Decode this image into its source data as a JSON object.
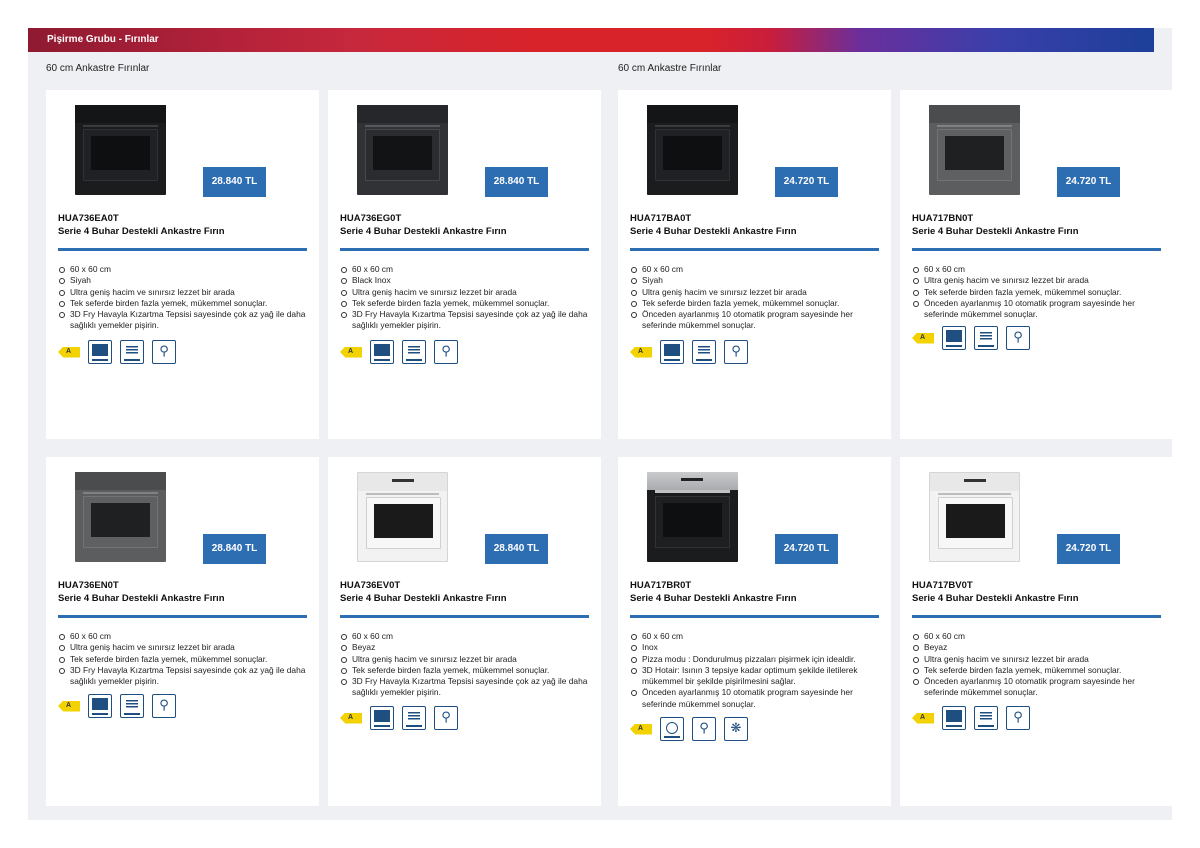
{
  "banner": {
    "title": "Pişirme Grubu - Fırınlar"
  },
  "sections": [
    "60 cm Ankastre Fırınlar",
    "60 cm Ankastre Fırınlar"
  ],
  "colors": {
    "accent": "#2d6db2",
    "energy": "#f2d200",
    "icon": "#1f4e80"
  },
  "products": [
    {
      "model": "HUA736EA0T",
      "name": "Serie 4 Buhar Destekli Ankastre Fırın",
      "price": "28.840 TL",
      "features": [
        "60 x 60 cm",
        "Siyah",
        "Ultra geniş hacim ve sınırsız lezzet bir arada",
        "Tek seferde birden fazla yemek, mükemmel sonuçlar.",
        "3D Fry Havayla Kızartma Tepsisi sayesinde çok az yağ ile daha sağlıklı yemekler pişirin."
      ]
    },
    {
      "model": "HUA736EG0T",
      "name": "Serie 4 Buhar Destekli Ankastre Fırın",
      "price": "28.840 TL",
      "features": [
        "60 x 60 cm",
        "Black Inox",
        "Ultra geniş hacim ve sınırsız lezzet bir arada",
        "Tek seferde birden fazla yemek, mükemmel sonuçlar.",
        "3D Fry Havayla Kızartma Tepsisi sayesinde çok az yağ ile daha sağlıklı yemekler pişirin."
      ]
    },
    {
      "model": "HUA717BA0T",
      "name": "Serie 4 Buhar Destekli Ankastre Fırın",
      "price": "24.720 TL",
      "features": [
        "60 x 60 cm",
        "Siyah",
        "Ultra geniş hacim ve sınırsız lezzet bir arada",
        "Tek seferde birden fazla yemek, mükemmel sonuçlar.",
        "Önceden ayarlanmış 10 otomatik program sayesinde her seferinde mükemmel sonuçlar."
      ]
    },
    {
      "model": "HUA717BN0T",
      "name": "Serie 4 Buhar Destekli Ankastre Fırın",
      "price": "24.720 TL",
      "features": [
        "60 x 60 cm",
        "Ultra geniş hacim ve sınırsız lezzet bir arada",
        "Tek seferde birden fazla yemek, mükemmel sonuçlar.",
        "Önceden ayarlanmış 10 otomatik program sayesinde her seferinde mükemmel sonuçlar."
      ]
    },
    {
      "model": "HUA736EN0T",
      "name": "Serie 4 Buhar Destekli Ankastre Fırın",
      "price": "28.840 TL",
      "features": [
        "60 x 60 cm",
        "Ultra geniş hacim ve sınırsız lezzet bir arada",
        "Tek seferde birden fazla yemek, mükemmel sonuçlar.",
        "3D Fry Havayla Kızartma Tepsisi sayesinde çok az yağ ile daha sağlıklı yemekler pişirin."
      ]
    },
    {
      "model": "HUA736EV0T",
      "name": "Serie 4 Buhar Destekli Ankastre Fırın",
      "price": "28.840 TL",
      "features": [
        "60 x 60 cm",
        "Beyaz",
        "Ultra geniş hacim ve sınırsız lezzet bir arada",
        "Tek seferde birden fazla yemek, mükemmel sonuçlar.",
        "3D Fry Havayla Kızartma Tepsisi sayesinde çok az yağ ile daha sağlıklı yemekler pişirin."
      ]
    },
    {
      "model": "HUA717BR0T",
      "name": "Serie 4 Buhar Destekli Ankastre Fırın",
      "price": "24.720 TL",
      "features": [
        "60 x 60 cm",
        "Inox",
        "Pizza modu : Dondurulmuş pizzaları pişirmek için idealdir.",
        "3D Hotair: Isının 3 tepsiye kadar optimum şekilde iletilerek mükemmel bir şekilde pişirilmesini sağlar.",
        "Önceden ayarlanmış 10 otomatik program sayesinde her seferinde mükemmel sonuçlar."
      ]
    },
    {
      "model": "HUA717BV0T",
      "name": "Serie 4 Buhar Destekli Ankastre Fırın",
      "price": "24.720 TL",
      "features": [
        "60 x 60 cm",
        "Beyaz",
        "Ultra geniş hacim ve sınırsız lezzet bir arada",
        "Tek seferde birden fazla yemek, mükemmel sonuçlar.",
        "Önceden ayarlanmış 10 otomatik program sayesinde her seferinde mükemmel sonuçlar."
      ]
    }
  ]
}
